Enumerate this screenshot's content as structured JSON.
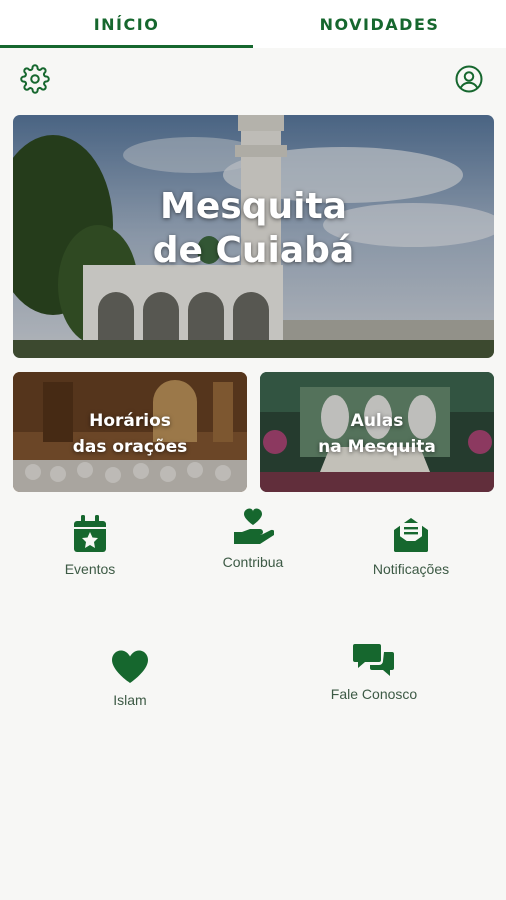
{
  "tabs": [
    {
      "label": "INÍCIO",
      "active": true
    },
    {
      "label": "NOVIDADES",
      "active": false
    }
  ],
  "header": {
    "settings_icon": "gear-icon",
    "profile_icon": "user-circle-icon"
  },
  "hero": {
    "line1": "Mesquita",
    "line2": "de Cuiabá"
  },
  "cards": [
    {
      "line1": "Horários",
      "line2": "das orações"
    },
    {
      "line1": "Aulas",
      "line2": "na Mesquita"
    }
  ],
  "features": {
    "eventos": {
      "label": "Eventos",
      "icon": "calendar-star-icon"
    },
    "contribua": {
      "label": "Contribua",
      "icon": "hand-heart-icon"
    },
    "notificacoes": {
      "label": "Notificações",
      "icon": "envelope-open-icon"
    },
    "islam": {
      "label": "Islam",
      "icon": "heart-icon"
    },
    "fale": {
      "label": "Fale Conosco",
      "icon": "chat-bubbles-icon"
    }
  },
  "colors": {
    "primary": "#16672e",
    "background": "#f7f7f5"
  }
}
